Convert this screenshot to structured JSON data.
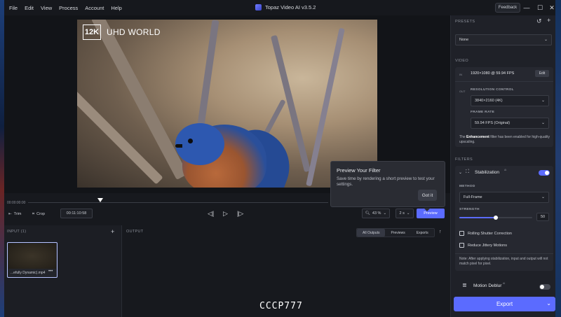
{
  "menu": [
    "File",
    "Edit",
    "View",
    "Process",
    "Account",
    "Help"
  ],
  "app_title": "Topaz Video AI  v3.5.2",
  "feedback_label": "Feedback",
  "window_controls": {
    "minimize": "—",
    "maximize": "☐",
    "close": "✕"
  },
  "video": {
    "brand_icon_text": "12K",
    "brand_text": "UHD WORLD"
  },
  "timeline": {
    "start_time": "00:00:00:00",
    "trim_label": "Trim",
    "crop_label": "Crop",
    "timecode": "00:11:10:58",
    "zoom_value": "43 %",
    "speed_value": "2 s",
    "preview_label": "Preview",
    "playhead_fraction": 0.24
  },
  "tooltip": {
    "title": "Preview Your Filter",
    "body": "Save time by rendering a short preview to test your settings.",
    "button": "Got it"
  },
  "input_panel": {
    "title": "INPUT (1)",
    "file_name": "...efully Dynamic).mp4",
    "more": "•••"
  },
  "output_panel": {
    "title": "OUTPUT",
    "tabs": [
      "All Outputs",
      "Previews",
      "Exports"
    ],
    "active_tab": "All Outputs"
  },
  "watermark": "CCCP777",
  "sidebar": {
    "presets_label": "PRESETS",
    "preset_value": "None",
    "video_label": "VIDEO",
    "in_tag": "IN",
    "in_resolution": "1920×1080 @ 59.94 FPS",
    "edit_label": "Edit",
    "out_tag": "OUT",
    "resolution_control_label": "RESOLUTION CONTROL",
    "resolution_value": "3840×2160 (4K)",
    "frame_rate_label": "FRAME RATE",
    "frame_rate_value": "59.94 FPS (Original)",
    "note_prefix": "The ",
    "note_bold": "Enhancement",
    "note_suffix": " filter has been enabled for high-quality upscaling.",
    "filters_label": "FILTERS",
    "stabilization_label": "Stabilization",
    "stabilization_ai_mark": "AI",
    "stabilization_enabled": true,
    "method_label": "METHOD",
    "method_value": "Full-Frame",
    "strength_label": "STRENGTH",
    "strength_value": "50",
    "strength_fraction": 0.5,
    "rolling_shutter_label": "Rolling Shutter Correction",
    "jittery_label": "Reduce Jittery Motions",
    "stab_note": "Note: After applying stabilization, input and output will not match pixel for pixel.",
    "motion_deblur_label": "Motion Deblur",
    "motion_deblur_ai_mark": "AI",
    "motion_deblur_enabled": false,
    "export_label": "Export"
  },
  "colors": {
    "accent": "#5b6bff",
    "panel": "#1f2128",
    "background": "#1b1d23"
  }
}
